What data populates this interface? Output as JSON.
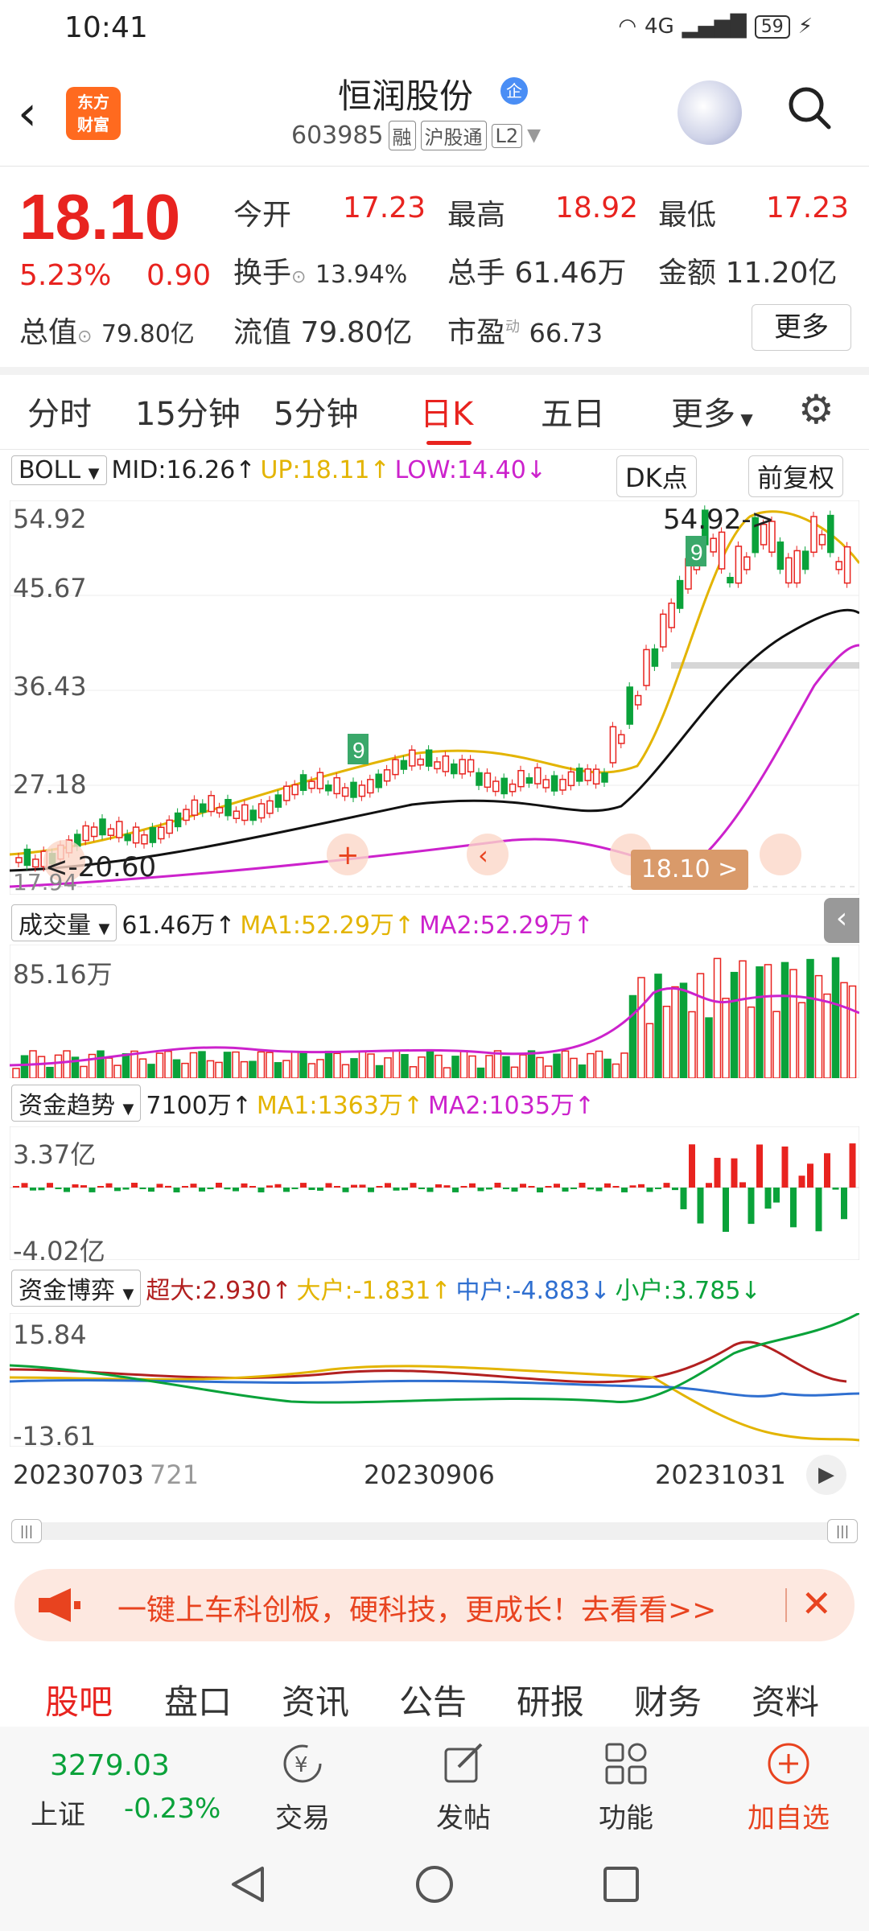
{
  "status": {
    "time": "10:41",
    "network": "4G",
    "battery": "59"
  },
  "header": {
    "logo_line1": "东方",
    "logo_line2": "财富",
    "name": "恒润股份",
    "badge": "企",
    "code": "603985",
    "tags": [
      "融",
      "沪股通",
      "L2"
    ]
  },
  "quote": {
    "price": "18.10",
    "pct": "5.23%",
    "change": "0.90",
    "open_label": "今开",
    "open": "17.23",
    "high_label": "最高",
    "high": "18.92",
    "low_label": "最低",
    "low": "17.23",
    "turnover_label": "换手",
    "turnover": "13.94%",
    "vol_label": "总手",
    "vol": "61.46万",
    "amount_label": "金额",
    "amount": "11.20亿",
    "mcap_label": "总值",
    "mcap": "79.80亿",
    "float_label": "流值",
    "float": "79.80亿",
    "pe_label": "市盈",
    "pe_sup": "动",
    "pe": "66.73",
    "more": "更多"
  },
  "tabs": [
    "分时",
    "15分钟",
    "5分钟",
    "日K",
    "五日",
    "更多"
  ],
  "boll": {
    "name": "BOLL",
    "mid": "MID:16.26↑",
    "up": "UP:18.11↑",
    "low": "LOW:14.40↓",
    "dk": "DK点",
    "fuquan": "前复权"
  },
  "kline_axis": {
    "y1": "54.92",
    "y2": "45.67",
    "y3": "36.43",
    "y4": "27.18",
    "y5": "17.94",
    "max_label": "54.92->",
    "min_label": "<-20.60",
    "current_badge": "18.10 >"
  },
  "volume": {
    "name": "成交量",
    "value": "61.46万↑",
    "ma1": "MA1:52.29万↑",
    "ma2": "MA2:52.29万↑",
    "axis_top": "85.16万"
  },
  "fund_trend": {
    "name": "资金趋势",
    "value": "7100万↑",
    "ma1": "MA1:1363万↑",
    "ma2": "MA2:1035万↑",
    "axis_top": "3.37亿",
    "axis_bottom": "-4.02亿"
  },
  "fund_game": {
    "name": "资金博弈",
    "super": "超大:2.930↑",
    "large": "大户:-1.831↑",
    "medium": "中户:-4.883↓",
    "small": "小户:3.785↓",
    "axis_top": "15.84",
    "axis_bottom": "-13.61"
  },
  "dates": [
    "20230703",
    "721",
    "20230906",
    "20231031"
  ],
  "banner": {
    "text": "一键上车科创板，硬科技，更成长！去看看>>"
  },
  "bottom_tabs": [
    "股吧",
    "盘口",
    "资讯",
    "公告",
    "研报",
    "财务",
    "资料"
  ],
  "bottom_nav": {
    "index_value": "3279.03",
    "index_name": "上证",
    "index_change": "-0.23%",
    "trade": "交易",
    "post": "发帖",
    "features": "功能",
    "add": "加自选"
  },
  "colors": {
    "up": "#e8231f",
    "down": "#0aa23a",
    "accent": "#e8231f",
    "yellow": "#e3b400",
    "magenta": "#cc22cc",
    "blue": "#2f6fd0"
  }
}
